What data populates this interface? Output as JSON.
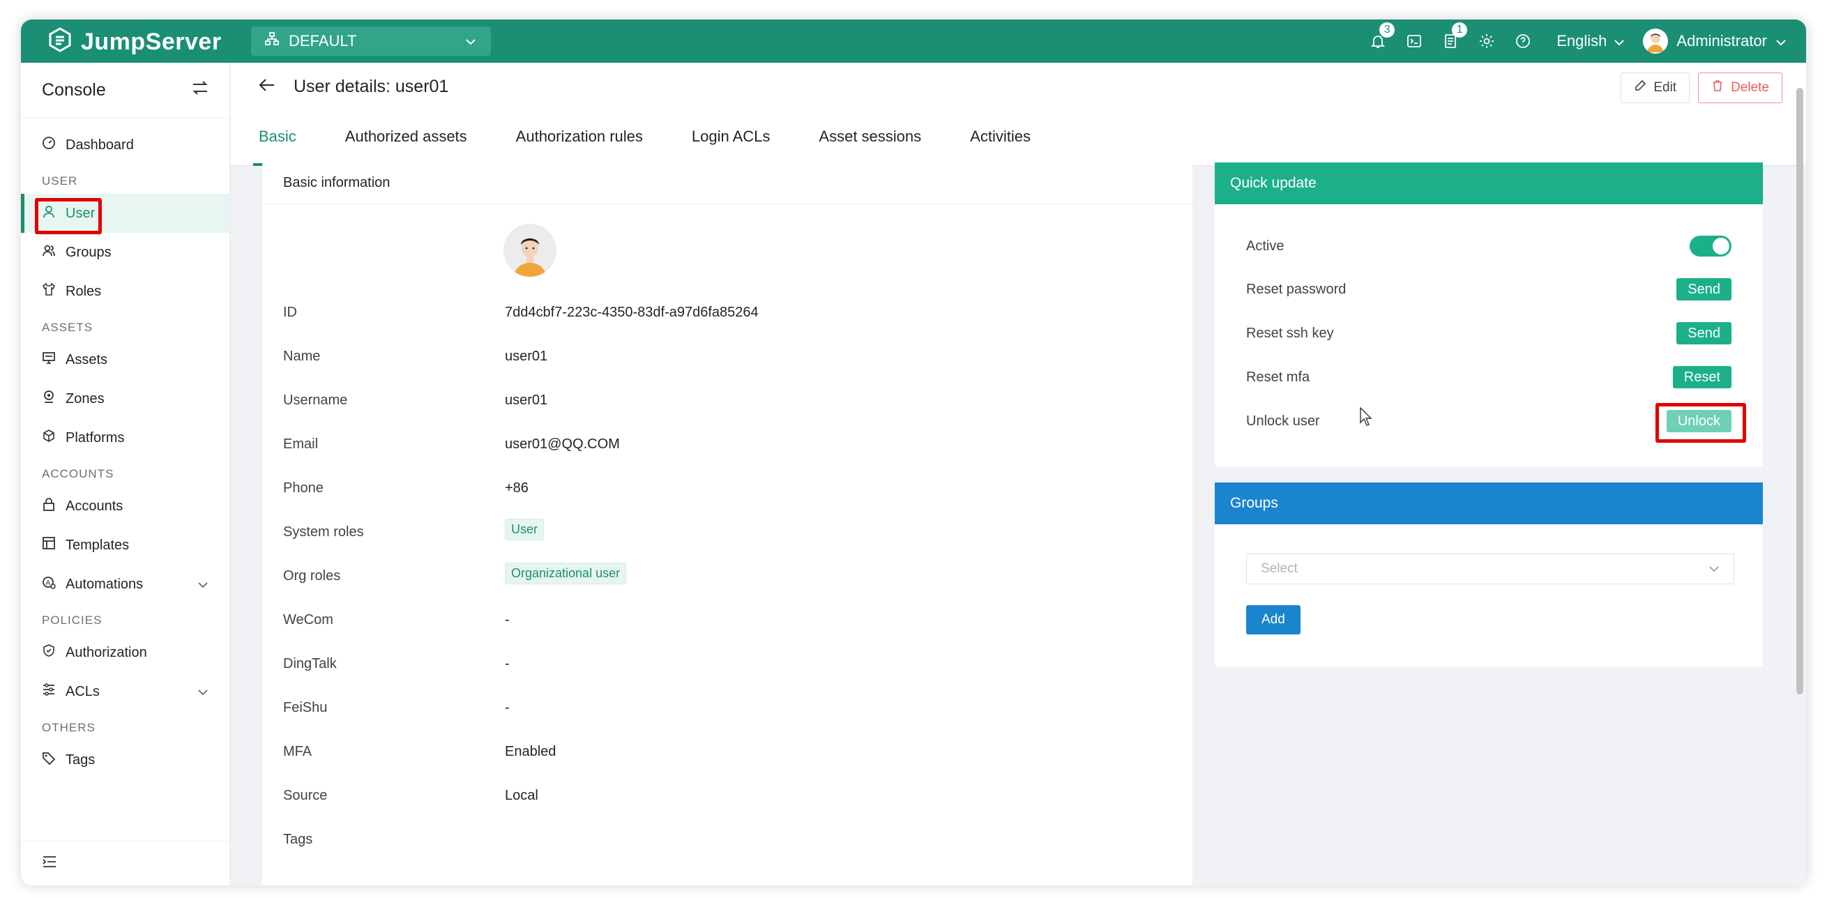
{
  "topbar": {
    "brand": "JumpServer",
    "org": "DEFAULT",
    "notifications_count": "3",
    "tasks_count": "1",
    "language": "English",
    "user_name": "Administrator"
  },
  "sidebar": {
    "console_label": "Console",
    "groups": [
      {
        "label": "USER",
        "items": [
          {
            "label": "User"
          },
          {
            "label": "Groups"
          },
          {
            "label": "Roles"
          }
        ]
      },
      {
        "label": "ASSETS",
        "items": [
          {
            "label": "Assets"
          },
          {
            "label": "Zones"
          },
          {
            "label": "Platforms"
          }
        ]
      },
      {
        "label": "ACCOUNTS",
        "items": [
          {
            "label": "Accounts"
          },
          {
            "label": "Templates"
          },
          {
            "label": "Automations"
          }
        ]
      },
      {
        "label": "POLICIES",
        "items": [
          {
            "label": "Authorization"
          },
          {
            "label": "ACLs"
          }
        ]
      },
      {
        "label": "OTHERS",
        "items": [
          {
            "label": "Tags"
          }
        ]
      }
    ],
    "dashboard_label": "Dashboard"
  },
  "header": {
    "title": "User details: user01",
    "edit_label": "Edit",
    "delete_label": "Delete",
    "tabs": [
      "Basic",
      "Authorized assets",
      "Authorization rules",
      "Login ACLs",
      "Asset sessions",
      "Activities"
    ]
  },
  "basic": {
    "title": "Basic information",
    "fields": [
      {
        "key": "ID",
        "value": "7dd4cbf7-223c-4350-83df-a97d6fa85264"
      },
      {
        "key": "Name",
        "value": "user01"
      },
      {
        "key": "Username",
        "value": "user01"
      },
      {
        "key": "Email",
        "value": "user01@QQ.COM"
      },
      {
        "key": "Phone",
        "value": "+86"
      },
      {
        "key": "System roles",
        "value": "User"
      },
      {
        "key": "Org roles",
        "value": "Organizational user"
      },
      {
        "key": "WeCom",
        "value": "-"
      },
      {
        "key": "DingTalk",
        "value": "-"
      },
      {
        "key": "FeiShu",
        "value": "-"
      },
      {
        "key": "MFA",
        "value": "Enabled"
      },
      {
        "key": "Source",
        "value": "Local"
      },
      {
        "key": "Tags",
        "value": ""
      }
    ]
  },
  "quick": {
    "title": "Quick update",
    "active_label": "Active",
    "reset_password_label": "Reset password",
    "reset_password_btn": "Send",
    "reset_ssh_label": "Reset ssh key",
    "reset_ssh_btn": "Send",
    "reset_mfa_label": "Reset mfa",
    "reset_mfa_btn": "Reset",
    "unlock_label": "Unlock user",
    "unlock_btn": "Unlock"
  },
  "groups_card": {
    "title": "Groups",
    "select_placeholder": "Select",
    "add_label": "Add"
  },
  "colors": {
    "brand": "#1a8f73",
    "quick_header": "#1bb08a",
    "groups_header": "#1a85cf",
    "highlight": "#e00000"
  }
}
